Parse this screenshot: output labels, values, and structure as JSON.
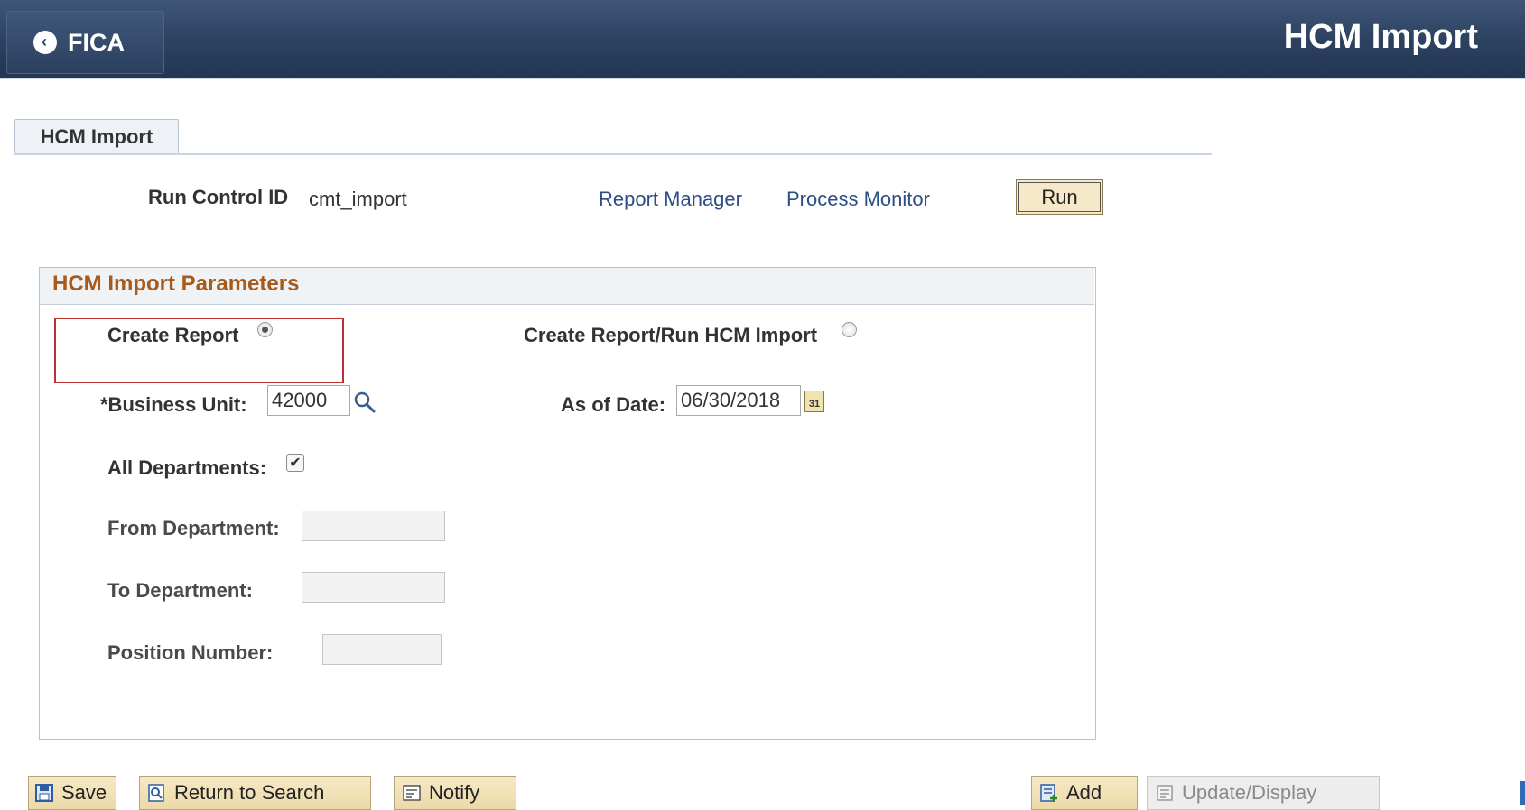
{
  "header": {
    "back_label": "FICA",
    "page_title": "HCM Import"
  },
  "tab": {
    "label": "HCM Import"
  },
  "run_control": {
    "label": "Run Control ID",
    "value": "cmt_import",
    "report_manager_link": "Report Manager",
    "process_monitor_link": "Process Monitor",
    "run_label": "Run"
  },
  "params": {
    "title": "HCM Import Parameters",
    "create_report_label": "Create Report",
    "create_report_checked": true,
    "create_run_label": "Create Report/Run HCM Import",
    "create_run_checked": false,
    "business_unit_label": "*Business Unit:",
    "business_unit_value": "42000",
    "as_of_date_label": "As of Date:",
    "as_of_date_value": "06/30/2018",
    "calendar_icon_text": "31",
    "all_departments_label": "All Departments:",
    "all_departments_checked": true,
    "from_department_label": "From Department:",
    "from_department_value": "",
    "to_department_label": "To Department:",
    "to_department_value": "",
    "position_number_label": "Position Number:",
    "position_number_value": ""
  },
  "toolbar": {
    "save_label": "Save",
    "return_label": "Return to Search",
    "notify_label": "Notify",
    "add_label": "Add",
    "update_label": "Update/Display"
  },
  "colors": {
    "header_bg": "#2c4160",
    "group_title": "#a85a1a",
    "link": "#2b4f86",
    "highlight_box": "#c03030"
  }
}
